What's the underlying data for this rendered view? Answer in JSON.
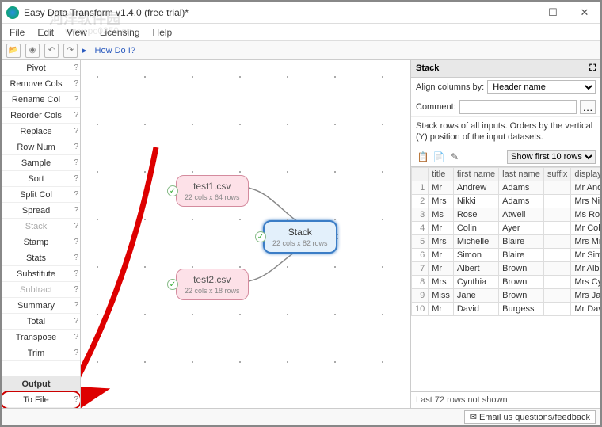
{
  "window": {
    "title": "Easy Data Transform v1.4.0 (free trial)*"
  },
  "menu": [
    "File",
    "Edit",
    "View",
    "Licensing",
    "Help"
  ],
  "toolbar": {
    "howdoi": "How Do I?"
  },
  "sidebar": {
    "items": [
      {
        "label": "Pivot",
        "gray": false
      },
      {
        "label": "Remove Cols",
        "gray": false
      },
      {
        "label": "Rename Col",
        "gray": false
      },
      {
        "label": "Reorder Cols",
        "gray": false
      },
      {
        "label": "Replace",
        "gray": false
      },
      {
        "label": "Row Num",
        "gray": false
      },
      {
        "label": "Sample",
        "gray": false
      },
      {
        "label": "Sort",
        "gray": false
      },
      {
        "label": "Split Col",
        "gray": false
      },
      {
        "label": "Spread",
        "gray": false
      },
      {
        "label": "Stack",
        "gray": true
      },
      {
        "label": "Stamp",
        "gray": false
      },
      {
        "label": "Stats",
        "gray": false
      },
      {
        "label": "Substitute",
        "gray": false
      },
      {
        "label": "Subtract",
        "gray": true
      },
      {
        "label": "Summary",
        "gray": false
      },
      {
        "label": "Total",
        "gray": false
      },
      {
        "label": "Transpose",
        "gray": false
      },
      {
        "label": "Trim",
        "gray": false
      }
    ],
    "output_header": "Output",
    "to_file": "To File"
  },
  "canvas": {
    "node1": {
      "title": "test1.csv",
      "sub": "22 cols x 64 rows"
    },
    "node2": {
      "title": "test2.csv",
      "sub": "22 cols x 18 rows"
    },
    "stack": {
      "title": "Stack",
      "sub": "22 cols x 82 rows"
    }
  },
  "panel": {
    "title": "Stack",
    "align_label": "Align columns by:",
    "align_value": "Header name",
    "comment_label": "Comment:",
    "comment_value": "",
    "desc": "Stack rows of all inputs. Orders by the vertical (Y) position of the input datasets.",
    "showrows": "Show first 10 rows",
    "columns": [
      "",
      "title",
      "first name",
      "last name",
      "suffix",
      "display name"
    ],
    "rows": [
      [
        "1",
        "Mr",
        "Andrew",
        "Adams",
        "",
        "Mr Andrew"
      ],
      [
        "2",
        "Mrs",
        "Nikki",
        "Adams",
        "",
        "Mrs Nikki A"
      ],
      [
        "3",
        "Ms",
        "Rose",
        "Atwell",
        "",
        "Ms Rose At"
      ],
      [
        "4",
        "Mr",
        "Colin",
        "Ayer",
        "",
        "Mr Colin Ay"
      ],
      [
        "5",
        "Mrs",
        "Michelle",
        "Blaire",
        "",
        "Mrs Michel"
      ],
      [
        "6",
        "Mr",
        "Simon",
        "Blaire",
        "",
        "Mr Simon B"
      ],
      [
        "7",
        "Mr",
        "Albert",
        "Brown",
        "",
        "Mr Albert B"
      ],
      [
        "8",
        "Mrs",
        "Cynthia",
        "Brown",
        "",
        "Mrs Cynthia"
      ],
      [
        "9",
        "Miss",
        "Jane",
        "Brown",
        "",
        "Mrs Jane Br"
      ],
      [
        "10",
        "Mr",
        "David",
        "Burgess",
        "",
        "Mr David B"
      ]
    ],
    "footer": "Last 72 rows not shown"
  },
  "status": {
    "feedback": "✉ Email us questions/feedback"
  }
}
